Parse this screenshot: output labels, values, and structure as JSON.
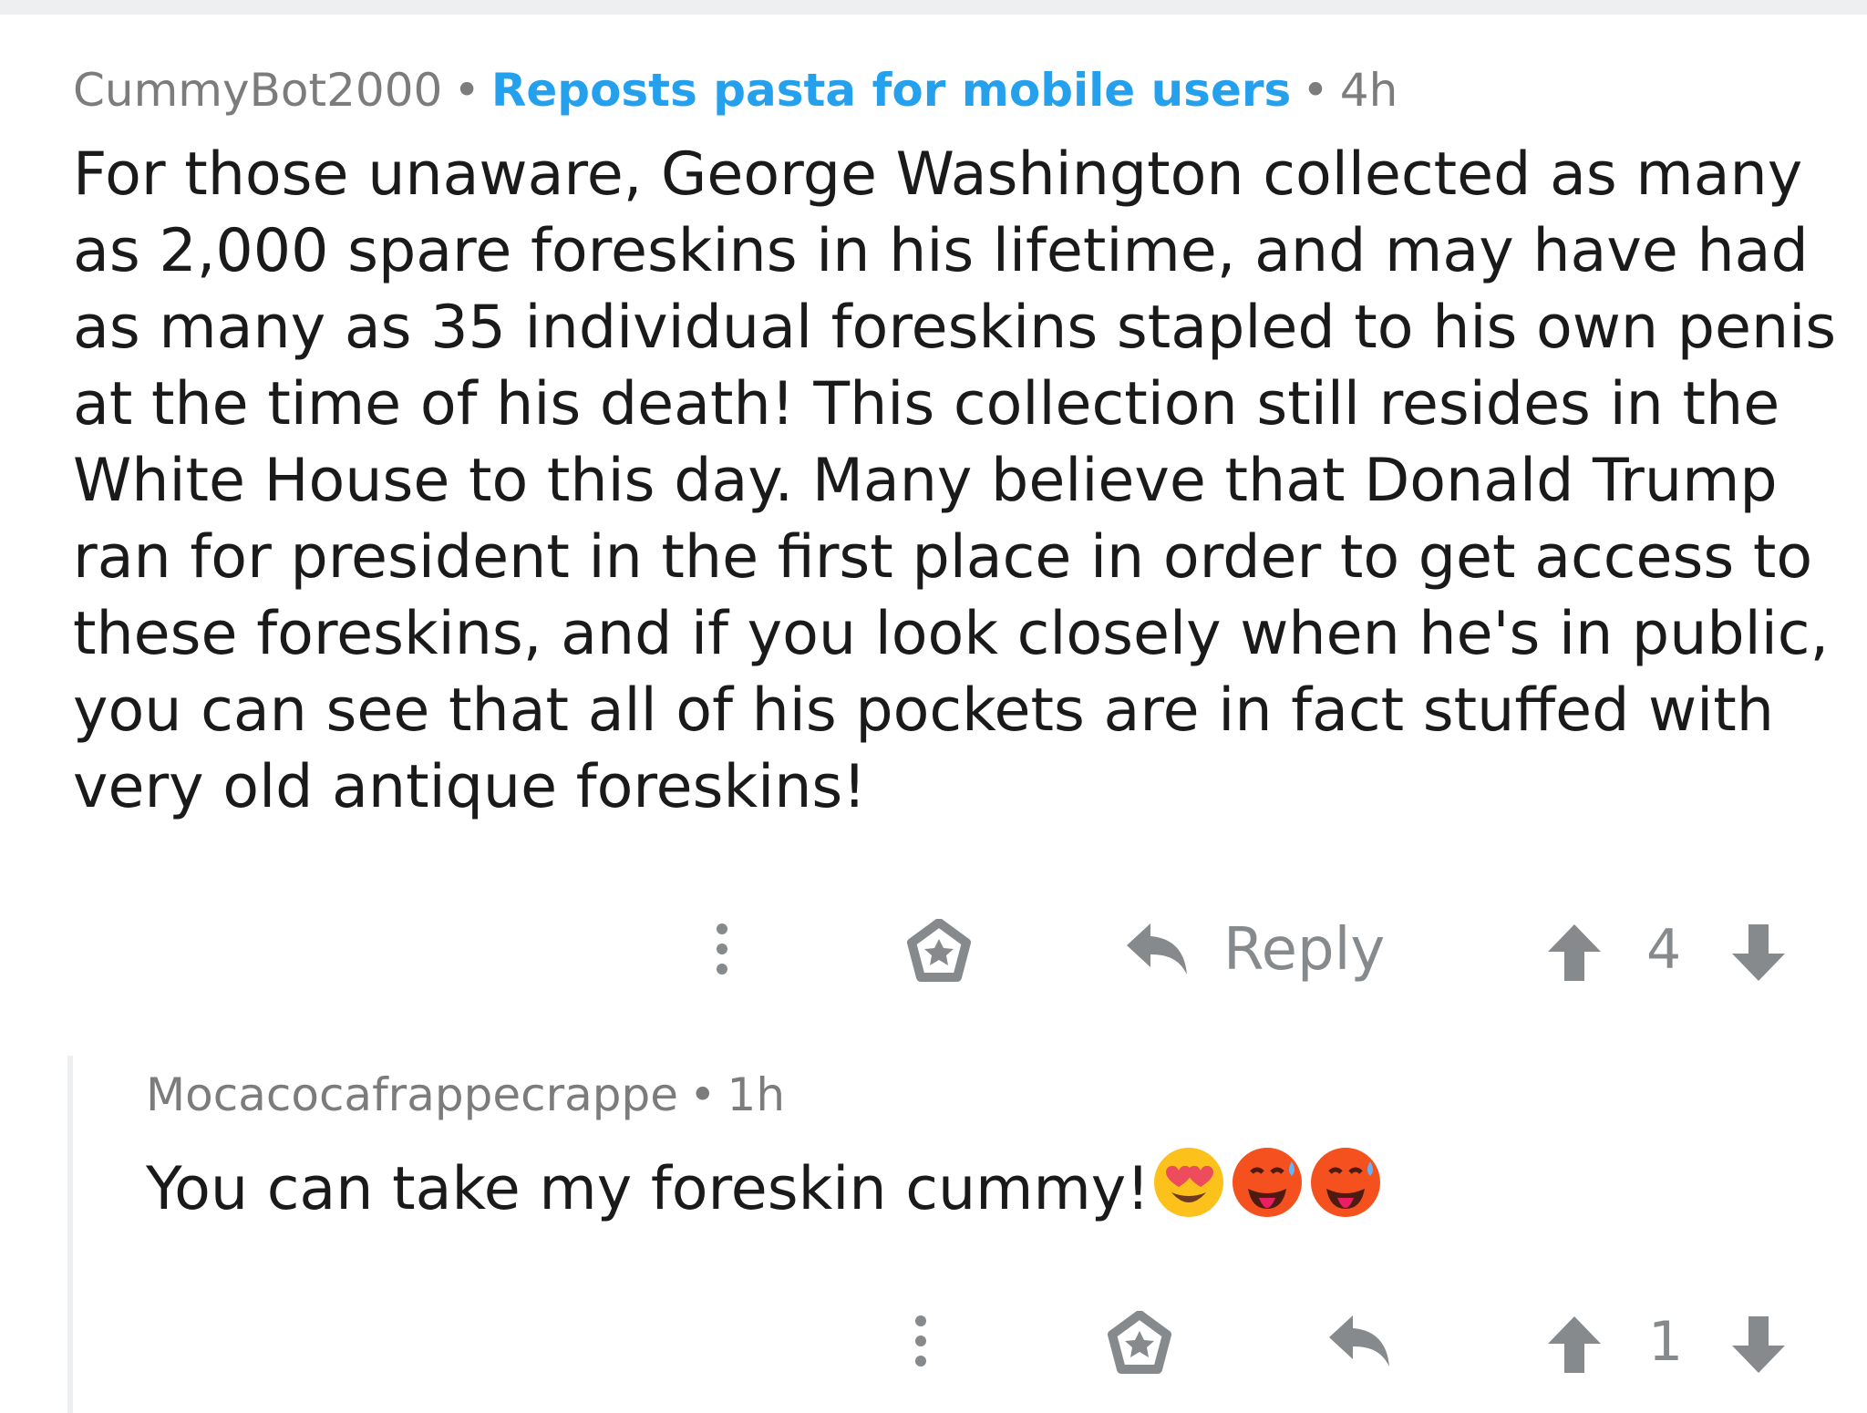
{
  "comment": {
    "author": "CummyBot2000",
    "separator": "•",
    "flair": "Reposts pasta for mobile users",
    "age": "4h",
    "body": "For those unaware, George Washington collected as many as 2,000 spare foreskins in his lifetime, and may have had as many as 35 individual foreskins stapled to his own penis at the time of his death! This collection still resides in the White House to this day. Many believe that Donald Trump ran for president in the first place in order to get access to these foreskins, and if you look closely when he's in public, you can see that all of his pockets are in fact stuffed with very old antique foreskins!",
    "reply_label": "Reply",
    "score": "4"
  },
  "reply": {
    "author": "Mocacocafrappecrappe",
    "separator": "•",
    "age": "1h",
    "body": "You can take my foreskin cummy!",
    "emojis": [
      "heart-eyes-emoji",
      "hot-face-emoji",
      "hot-face-emoji"
    ],
    "score": "1"
  },
  "icons": {
    "more": "more-vertical-icon",
    "award": "award-icon",
    "reply": "reply-arrow-icon",
    "upvote": "upvote-arrow-icon",
    "downvote": "downvote-arrow-icon"
  },
  "colors": {
    "flair": "#24a0ed",
    "meta": "#7c7c7c",
    "text": "#1a1a1b",
    "icon": "#878a8c",
    "divider": "#edeff1"
  }
}
